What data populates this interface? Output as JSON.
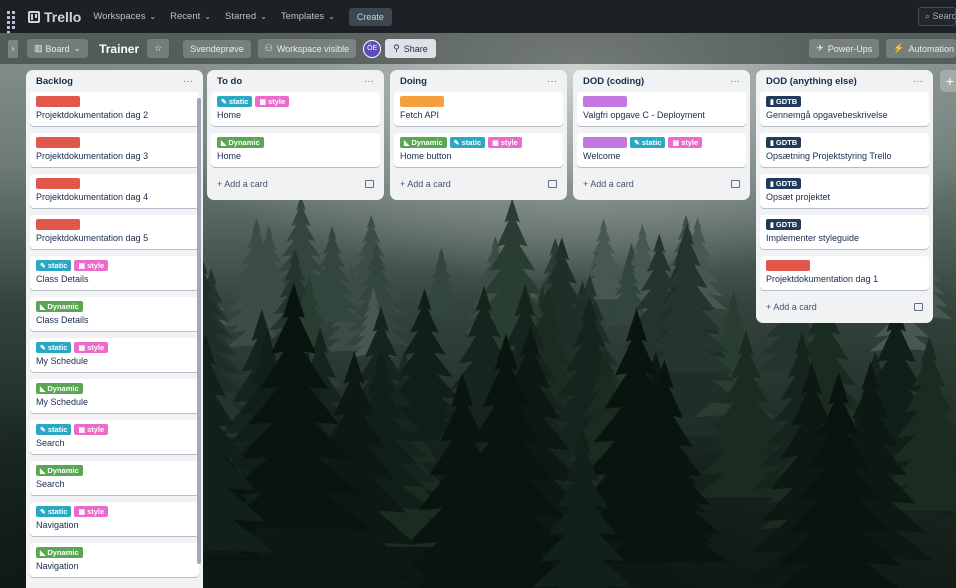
{
  "topbar": {
    "app_name": "Trello",
    "nav": [
      "Workspaces",
      "Recent",
      "Starred",
      "Templates"
    ],
    "create_label": "Create",
    "search_placeholder": "Search"
  },
  "board": {
    "view_label": "Board",
    "title": "Trainer",
    "workspace_name": "Svendeprøve",
    "visibility_label": "Workspace visible",
    "avatar_initials": "ÖE",
    "share_label": "Share",
    "powerups_label": "Power-Ups",
    "automation_label": "Automation"
  },
  "label_colors": {
    "red": "#e2574c",
    "orange": "#f5a03c",
    "purple": "#c377e0",
    "teal": "#2aa7c2",
    "pink": "#ea6bc9",
    "green": "#5aa653",
    "navy": "#1f3a5a"
  },
  "add_card_label": "+ Add a card",
  "lists": [
    {
      "title": "Backlog",
      "cards": [
        {
          "labels": [
            {
              "color": "red",
              "text": ""
            }
          ],
          "title": "Projektdokumentation dag 2"
        },
        {
          "labels": [
            {
              "color": "red",
              "text": ""
            }
          ],
          "title": "Projektdokumentation dag 3"
        },
        {
          "labels": [
            {
              "color": "red",
              "text": ""
            }
          ],
          "title": "Projektdokumentation dag 4"
        },
        {
          "labels": [
            {
              "color": "red",
              "text": ""
            }
          ],
          "title": "Projektdokumentation dag 5"
        },
        {
          "labels": [
            {
              "color": "teal",
              "text": "static"
            },
            {
              "color": "pink",
              "text": "style"
            }
          ],
          "title": "Class Details"
        },
        {
          "labels": [
            {
              "color": "green",
              "text": "Dynamic"
            }
          ],
          "title": "Class Details"
        },
        {
          "labels": [
            {
              "color": "teal",
              "text": "static"
            },
            {
              "color": "pink",
              "text": "style"
            }
          ],
          "title": "My Schedule"
        },
        {
          "labels": [
            {
              "color": "green",
              "text": "Dynamic"
            }
          ],
          "title": "My Schedule"
        },
        {
          "labels": [
            {
              "color": "teal",
              "text": "static"
            },
            {
              "color": "pink",
              "text": "style"
            }
          ],
          "title": "Search"
        },
        {
          "labels": [
            {
              "color": "green",
              "text": "Dynamic"
            }
          ],
          "title": "Search"
        },
        {
          "labels": [
            {
              "color": "teal",
              "text": "static"
            },
            {
              "color": "pink",
              "text": "style"
            }
          ],
          "title": "Navigation"
        },
        {
          "labels": [
            {
              "color": "green",
              "text": "Dynamic"
            }
          ],
          "title": "Navigation"
        }
      ]
    },
    {
      "title": "To do",
      "cards": [
        {
          "labels": [
            {
              "color": "teal",
              "text": "static"
            },
            {
              "color": "pink",
              "text": "style"
            }
          ],
          "title": "Home"
        },
        {
          "labels": [
            {
              "color": "green",
              "text": "Dynamic"
            }
          ],
          "title": "Home"
        }
      ]
    },
    {
      "title": "Doing",
      "cards": [
        {
          "labels": [
            {
              "color": "orange",
              "text": ""
            }
          ],
          "title": "Fetch API"
        },
        {
          "labels": [
            {
              "color": "green",
              "text": "Dynamic"
            },
            {
              "color": "teal",
              "text": "static"
            },
            {
              "color": "pink",
              "text": "style"
            }
          ],
          "title": "Home button"
        }
      ]
    },
    {
      "title": "DOD (coding)",
      "cards": [
        {
          "labels": [
            {
              "color": "purple",
              "text": ""
            }
          ],
          "title": "Valgfri opgave C - Deployment"
        },
        {
          "labels": [
            {
              "color": "purple",
              "text": ""
            },
            {
              "color": "teal",
              "text": "static"
            },
            {
              "color": "pink",
              "text": "style"
            }
          ],
          "title": "Welcome"
        }
      ]
    },
    {
      "title": "DOD (anything else)",
      "cards": [
        {
          "labels": [
            {
              "color": "navy",
              "text": "GDTB"
            }
          ],
          "title": "Gennemgå opgavebeskrivelse"
        },
        {
          "labels": [
            {
              "color": "navy",
              "text": "GDTB"
            }
          ],
          "title": "Opsætning Projektstyring Trello"
        },
        {
          "labels": [
            {
              "color": "navy",
              "text": "GDTB"
            }
          ],
          "title": "Opsæt projektet"
        },
        {
          "labels": [
            {
              "color": "navy",
              "text": "GDTB"
            }
          ],
          "title": "Implementer styleguide"
        },
        {
          "labels": [
            {
              "color": "red",
              "text": ""
            }
          ],
          "title": "Projektdokumentation dag 1"
        }
      ]
    }
  ]
}
